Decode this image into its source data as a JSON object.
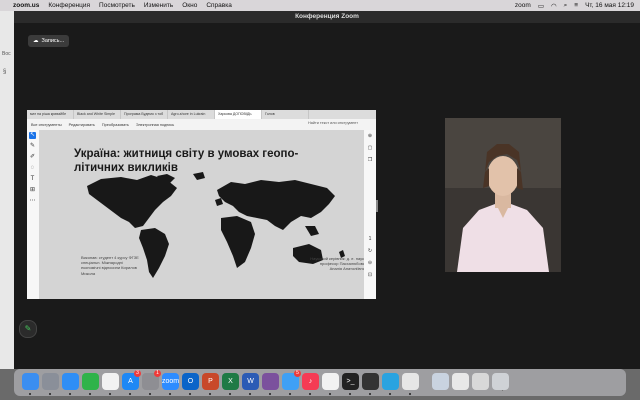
{
  "menubar": {
    "app": "zoom.us",
    "items": [
      "Конференция",
      "Посмотреть",
      "Изменить",
      "Окно",
      "Справка"
    ],
    "status_zoom": "zoom",
    "datetime": "Чт, 16 мая  12:19"
  },
  "background_window": {
    "label1": "Вос",
    "label2": "§"
  },
  "zoom_window": {
    "title": "Конференция Zoom",
    "recording_label": "Запись..."
  },
  "browser": {
    "tabs": [
      "мат на ріша кривайбе",
      "Black and White Simple",
      "Програма Будемо з тоб",
      "Agro-shore in Lukrain",
      "Харкова ДОПОВІДЬ",
      "Голов"
    ],
    "active_tab": 4,
    "toolbar_items": [
      "Все инструменты",
      "Редактировать",
      "Преобразовать",
      "Электронная подпись"
    ],
    "find_placeholder": "Найти текст или инструмент"
  },
  "slide": {
    "title": "Україна: житниця світу в умовах геопо­літичних викликів",
    "left_text": "Виконав: студент 4 курсу ФГЗЕ спеціальн. Міжнародні економічні відносини Кирилов Микола",
    "right_text": "Науковий керівник: д. е. наук, професор Пасхалюбова Аналія Анатоліївна"
  },
  "dock": {
    "apps": [
      {
        "name": "finder",
        "label": ""
      },
      {
        "name": "launchpad",
        "label": ""
      },
      {
        "name": "safari",
        "label": ""
      },
      {
        "name": "facetime",
        "label": ""
      },
      {
        "name": "photos",
        "label": ""
      },
      {
        "name": "app-store",
        "label": "A"
      },
      {
        "name": "settings",
        "label": ""
      },
      {
        "name": "zoom",
        "label": "zoom"
      },
      {
        "name": "outlook",
        "label": "O"
      },
      {
        "name": "powerpoint",
        "label": "P"
      },
      {
        "name": "excel",
        "label": "X"
      },
      {
        "name": "word",
        "label": "W"
      },
      {
        "name": "viber",
        "label": ""
      },
      {
        "name": "mail",
        "label": ""
      },
      {
        "name": "music",
        "label": "♪"
      },
      {
        "name": "chrome",
        "label": ""
      },
      {
        "name": "terminal",
        "label": ">_"
      },
      {
        "name": "activity-monitor",
        "label": ""
      },
      {
        "name": "telegram",
        "label": ""
      },
      {
        "name": "preview",
        "label": ""
      },
      {
        "name": "downloads",
        "label": ""
      },
      {
        "name": "recent-1",
        "label": ""
      },
      {
        "name": "recent-2",
        "label": ""
      },
      {
        "name": "trash",
        "label": ""
      }
    ],
    "badges": {
      "app-store": "3",
      "settings": "1",
      "mail": "5"
    }
  },
  "colors": {
    "zoom_bg": "#1a1a1a",
    "accent": "#1a73e8",
    "pen_green": "#47c25c",
    "slide_bg": "#d4d4d4"
  }
}
